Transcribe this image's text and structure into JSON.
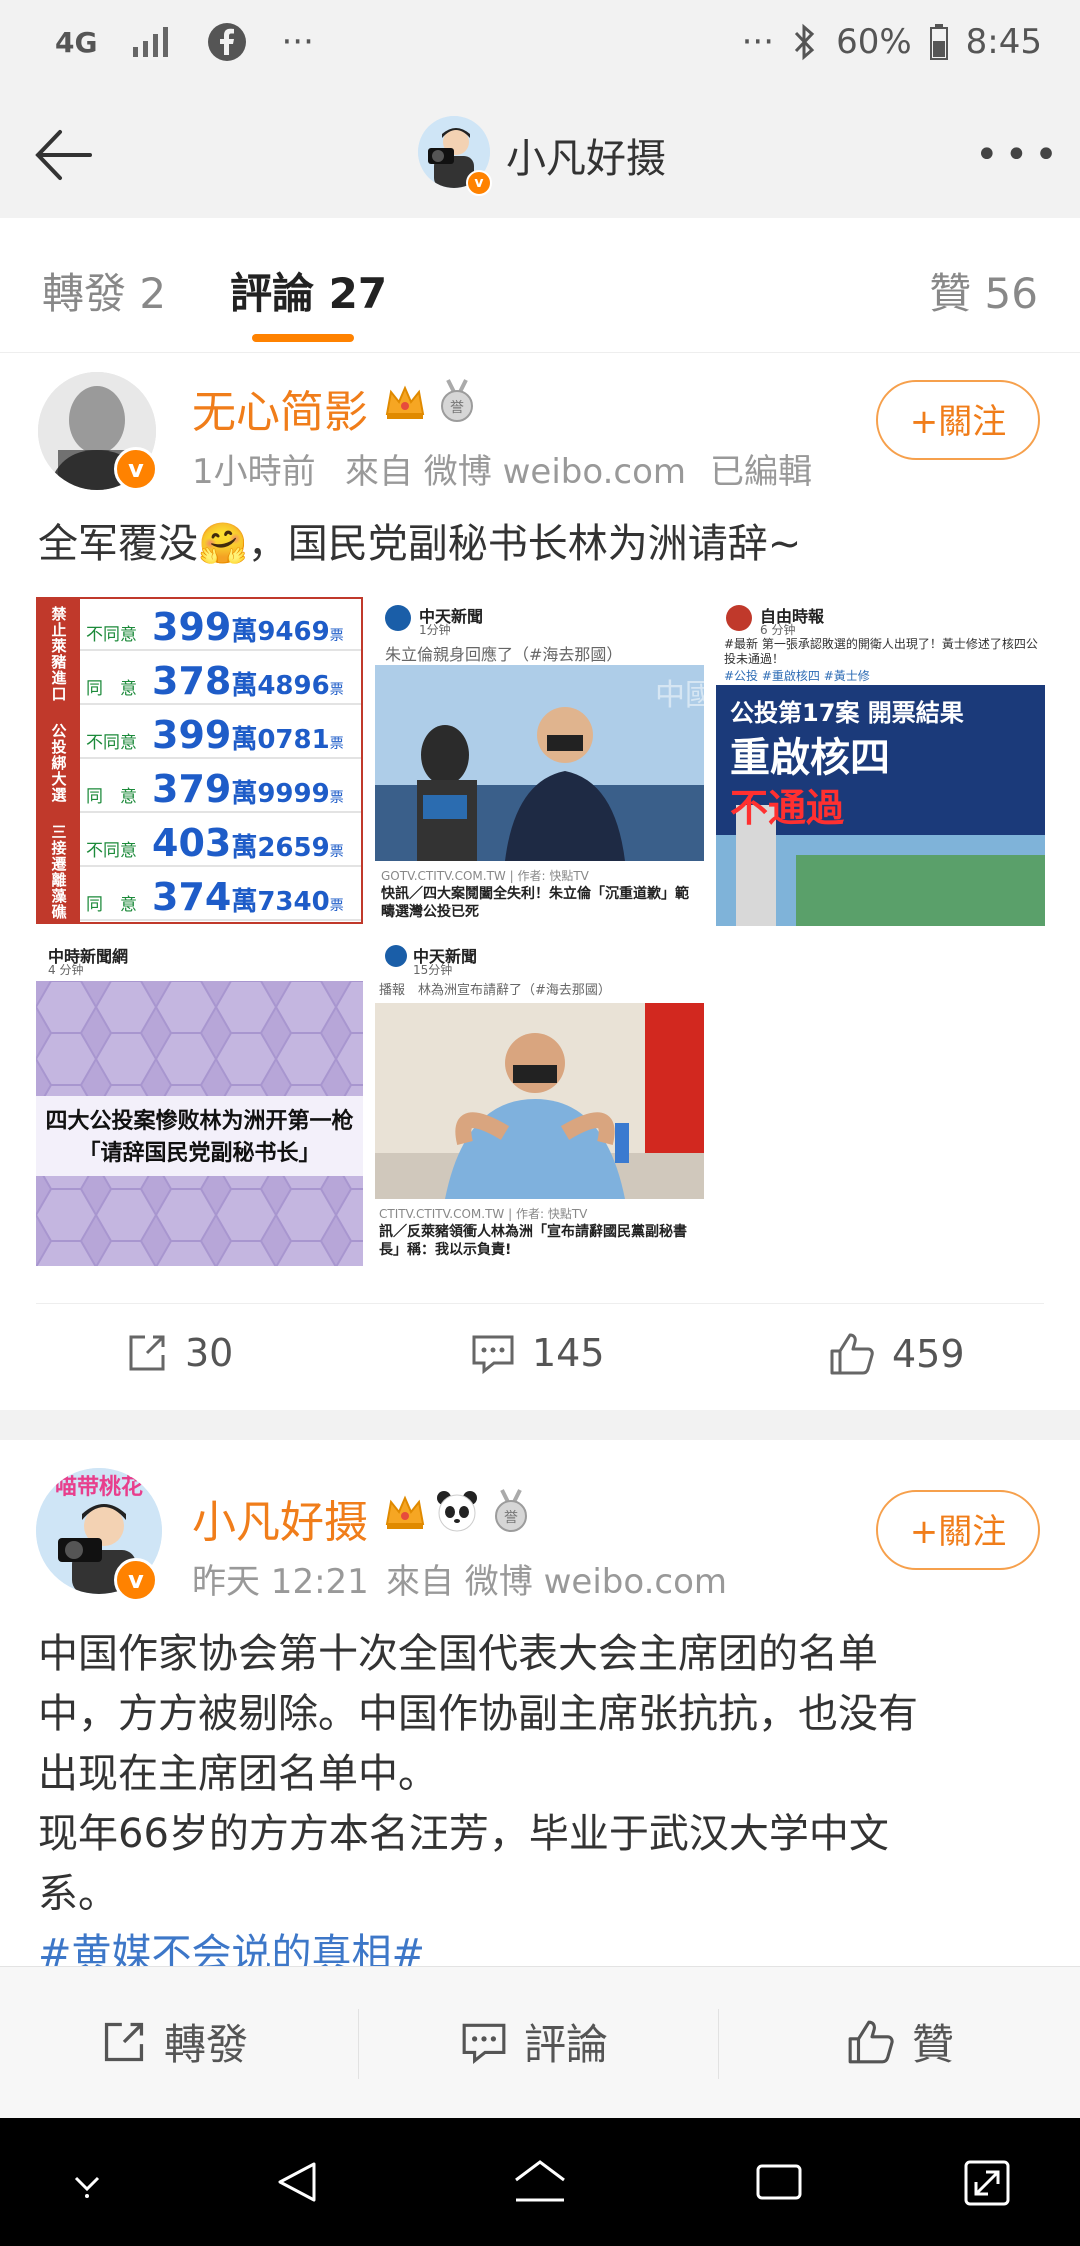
{
  "status_bar": {
    "network": "4G",
    "signal_icon": "signal-bars-icon",
    "facebook_icon": "facebook-icon",
    "dots_left": "···",
    "dots_right": "···",
    "bluetooth_icon": "bluetooth-icon",
    "battery": "60%",
    "time": "8:45"
  },
  "header": {
    "title": "小凡好摄",
    "avatar_icon": "photographer-avatar-icon",
    "more_label": "•••"
  },
  "tabs": {
    "repost": "轉發 2",
    "comments": "評論 27",
    "likes": "贊 56",
    "accent": "#ff8200"
  },
  "posts": [
    {
      "username": "无心简影",
      "time": "1小時前",
      "source": "來自 微博 weibo.com",
      "edited": "已編輯",
      "follow_label": "+關注",
      "text": "全军覆没🤗，国民党副秘书长林为洲请辞~",
      "images": [
        {
          "header": "禁止萊豬進口 / 公投綁大選 / 三接遷離藻礁",
          "rows": [
            {
              "label": "不同意",
              "big": "399",
              "small": "萬9469",
              "unit": "票"
            },
            {
              "label": "同　意",
              "big": "378",
              "small": "萬4896",
              "unit": "票"
            },
            {
              "label": "不同意",
              "big": "399",
              "small": "萬0781",
              "unit": "票"
            },
            {
              "label": "同　意",
              "big": "379",
              "small": "萬9999",
              "unit": "票"
            },
            {
              "label": "不同意",
              "big": "403",
              "small": "萬2659",
              "unit": "票"
            },
            {
              "label": "同　意",
              "big": "374",
              "small": "萬7340",
              "unit": "票"
            }
          ],
          "side_labels": [
            "禁止萊豬進口",
            "公投綁大選",
            "三接遷離藻礁"
          ]
        },
        {
          "source": "中天新聞",
          "time": "1分钟",
          "caption_top": "朱立倫親身回應了（#海去那國）",
          "caption_url": "GOTV.CTITV.COM.TW | 作者: 快點TV",
          "caption_bottom": "快訊／四大案鬩闔全失利！朱立倫「沉重道歉」範疇選灣公投已死"
        },
        {
          "source": "自由時報",
          "time": "6 分钟",
          "caption_top": "#最新 第一張承認敗選的開衛人出現了！黃士修述了核四公投未通過！",
          "tags": "#公投 #重啟核四 #黃士修",
          "headline_small": "公投第17案 開票結果",
          "headline": "重啟核四",
          "result": "不通過"
        },
        {
          "source": "中時新聞網",
          "time": "4 分钟",
          "headline1": "四大公投案惨败林为洲开第一枪",
          "headline2": "「请辞国民党副秘书长」"
        },
        {
          "source": "中天新聞",
          "time": "15分钟",
          "caption_top": "播報　林為洲宣布請辭了（#海去那國）",
          "caption_url": "CTITV.CTITV.COM.TW | 作者: 快點TV",
          "caption_bottom": "訊／反萊豬領衝人林為洲「宣布請辭國民黨副秘書長」稱：我以示負責!"
        }
      ],
      "stats": {
        "reposts": "30",
        "comments": "145",
        "likes": "459"
      }
    },
    {
      "username": "小凡好摄",
      "time": "昨天 12:21",
      "source": "來自 微博 weibo.com",
      "follow_label": "+關注",
      "text_lines": [
        "中国作家协会第十次全国代表大会主席团的名单",
        "中，方方被剔除。中国作协副主席张抗抗，也没有",
        "出现在主席团名单中。",
        "现年66岁的方方本名汪芳，毕业于武汉大学中文",
        "系。",
        "#黄媒不会说的真相#"
      ]
    }
  ],
  "bottom_bar": {
    "repost": "轉發",
    "comment": "評論",
    "like": "贊"
  }
}
